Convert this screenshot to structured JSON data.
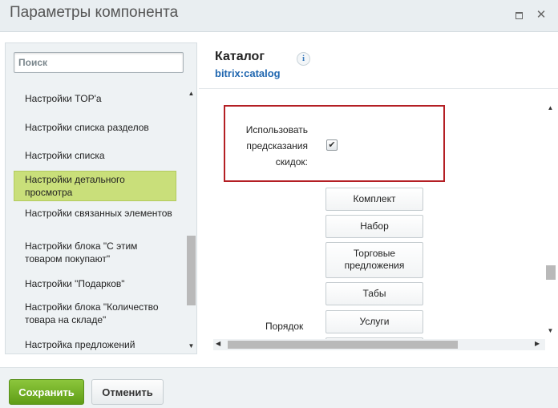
{
  "window": {
    "title": "Параметры компонента",
    "maximize_icon": "maximize-icon",
    "close_icon": "close-icon",
    "close_glyph": "✕"
  },
  "sidebar": {
    "search_placeholder": "Поиск",
    "items": [
      {
        "label": "Настройки TOP'а",
        "active": false
      },
      {
        "label": "Настройки списка разделов",
        "active": false
      },
      {
        "label": "Настройки списка",
        "active": false
      },
      {
        "label": "Настройки детального просмотра",
        "active": true
      },
      {
        "label": "Настройки связанных элементов",
        "active": false
      },
      {
        "label": "Настройки блока \"С этим товаром покупают\"",
        "active": false
      },
      {
        "label": "Настройки \"Подарков\"",
        "active": false
      },
      {
        "label": "Настройки блока \"Количество товара на складе\"",
        "active": false
      },
      {
        "label": "Настройка предложений",
        "active": false
      }
    ],
    "scroll_up": "▲",
    "scroll_down": "▼"
  },
  "main": {
    "heading": "Каталог",
    "component_id": "bitrix:catalog",
    "info_glyph": "i",
    "highlighted_property": {
      "label": "Использовать предсказания скидок:",
      "checked": true,
      "check_glyph": "✔"
    },
    "order_label": "Порядок",
    "order_buttons": [
      "Комплект",
      "Набор",
      "Торговые предложения",
      "Табы",
      "Услуги"
    ],
    "scroll_up": "▲",
    "scroll_down": "▼",
    "scroll_left": "◀",
    "scroll_right": "▶"
  },
  "footer": {
    "save_label": "Сохранить",
    "cancel_label": "Отменить"
  },
  "colors": {
    "accent_green": "#5f9d16",
    "active_item": "#c9df7a",
    "highlight_border": "#b41f24",
    "link_blue": "#2067b0"
  }
}
